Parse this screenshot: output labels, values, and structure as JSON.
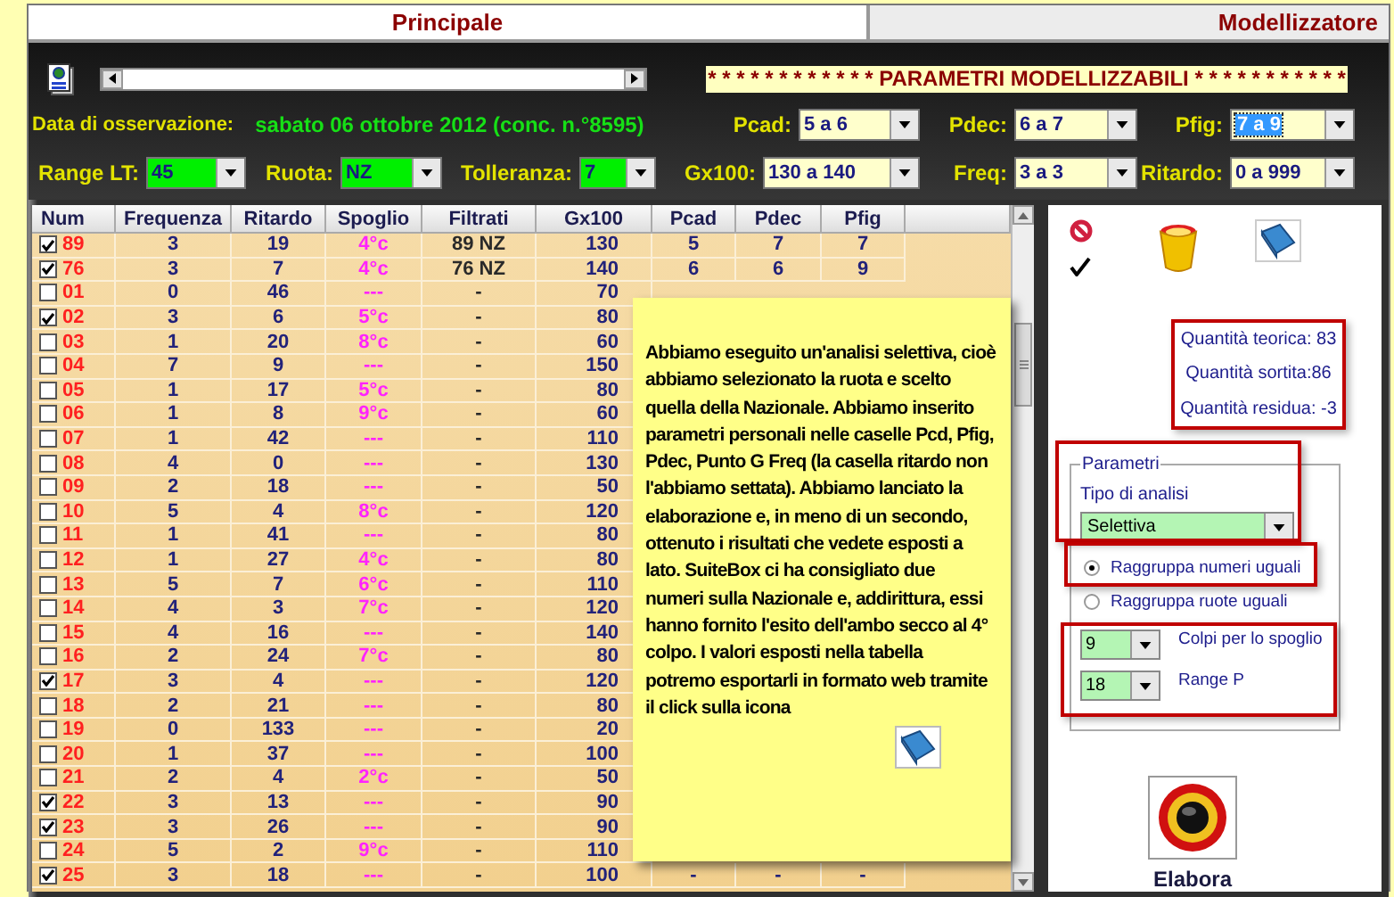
{
  "tabs": [
    {
      "label": "Principale",
      "selected": true
    },
    {
      "label": "Modellizzatore",
      "selected": false
    }
  ],
  "top": {
    "banner": "* * * * * * * * * * * * PARAMETRI MODELLIZZABILI * * * * * * * * * * *",
    "date_label": "Data di osservazione:",
    "date_value": "sabato 06 ottobre 2012 (conc. n.°8595)",
    "params_row1": [
      {
        "label": "Pcad:",
        "value": "5 a 6",
        "highlighted": false
      },
      {
        "label": "Pdec:",
        "value": "6 a 7",
        "highlighted": false
      },
      {
        "label": "Pfig:",
        "value": "7 a 9",
        "highlighted": true
      }
    ],
    "filters": [
      {
        "label": "Range LT:",
        "value": "45"
      },
      {
        "label": "Ruota:",
        "value": "NZ"
      },
      {
        "label": "Tolleranza:",
        "value": "7"
      }
    ],
    "params_row2": [
      {
        "label": "Gx100:",
        "value": "130 a 140",
        "highlighted": false
      },
      {
        "label": "Freq:",
        "value": "3 a 3",
        "highlighted": false
      },
      {
        "label": "Ritardo:",
        "value": "0 a 999",
        "highlighted": false
      }
    ]
  },
  "table": {
    "columns": [
      "Num",
      "Frequenza",
      "Ritardo",
      "Spoglio",
      "Filtrati",
      "Gx100",
      "Pcad",
      "Pdec",
      "Pfig"
    ],
    "rows": [
      {
        "num": "89",
        "checked": true,
        "freq": "3",
        "ritardo": "19",
        "spoglio": "4°c",
        "filtrati": "89 NZ",
        "gx100": "130",
        "pcad": "5",
        "pdec": "7",
        "pfig": "7"
      },
      {
        "num": "76",
        "checked": true,
        "freq": "3",
        "ritardo": "7",
        "spoglio": "4°c",
        "filtrati": "76 NZ",
        "gx100": "140",
        "pcad": "6",
        "pdec": "6",
        "pfig": "9"
      },
      {
        "num": "01",
        "checked": false,
        "freq": "0",
        "ritardo": "46",
        "spoglio": "---",
        "filtrati": "-",
        "gx100": "70"
      },
      {
        "num": "02",
        "checked": true,
        "freq": "3",
        "ritardo": "6",
        "spoglio": "5°c",
        "filtrati": "-",
        "gx100": "80"
      },
      {
        "num": "03",
        "checked": false,
        "freq": "1",
        "ritardo": "20",
        "spoglio": "8°c",
        "filtrati": "-",
        "gx100": "60"
      },
      {
        "num": "04",
        "checked": false,
        "freq": "7",
        "ritardo": "9",
        "spoglio": "---",
        "filtrati": "-",
        "gx100": "150"
      },
      {
        "num": "05",
        "checked": false,
        "freq": "1",
        "ritardo": "17",
        "spoglio": "5°c",
        "filtrati": "-",
        "gx100": "80"
      },
      {
        "num": "06",
        "checked": false,
        "freq": "1",
        "ritardo": "8",
        "spoglio": "9°c",
        "filtrati": "-",
        "gx100": "60"
      },
      {
        "num": "07",
        "checked": false,
        "freq": "1",
        "ritardo": "42",
        "spoglio": "---",
        "filtrati": "-",
        "gx100": "110"
      },
      {
        "num": "08",
        "checked": false,
        "freq": "4",
        "ritardo": "0",
        "spoglio": "---",
        "filtrati": "-",
        "gx100": "130"
      },
      {
        "num": "09",
        "checked": false,
        "freq": "2",
        "ritardo": "18",
        "spoglio": "---",
        "filtrati": "-",
        "gx100": "50"
      },
      {
        "num": "10",
        "checked": false,
        "freq": "5",
        "ritardo": "4",
        "spoglio": "8°c",
        "filtrati": "-",
        "gx100": "120"
      },
      {
        "num": "11",
        "checked": false,
        "freq": "1",
        "ritardo": "41",
        "spoglio": "---",
        "filtrati": "-",
        "gx100": "80"
      },
      {
        "num": "12",
        "checked": false,
        "freq": "1",
        "ritardo": "27",
        "spoglio": "4°c",
        "filtrati": "-",
        "gx100": "80"
      },
      {
        "num": "13",
        "checked": false,
        "freq": "5",
        "ritardo": "7",
        "spoglio": "6°c",
        "filtrati": "-",
        "gx100": "110"
      },
      {
        "num": "14",
        "checked": false,
        "freq": "4",
        "ritardo": "3",
        "spoglio": "7°c",
        "filtrati": "-",
        "gx100": "120"
      },
      {
        "num": "15",
        "checked": false,
        "freq": "4",
        "ritardo": "16",
        "spoglio": "---",
        "filtrati": "-",
        "gx100": "140"
      },
      {
        "num": "16",
        "checked": false,
        "freq": "2",
        "ritardo": "24",
        "spoglio": "7°c",
        "filtrati": "-",
        "gx100": "80"
      },
      {
        "num": "17",
        "checked": true,
        "freq": "3",
        "ritardo": "4",
        "spoglio": "---",
        "filtrati": "-",
        "gx100": "120"
      },
      {
        "num": "18",
        "checked": false,
        "freq": "2",
        "ritardo": "21",
        "spoglio": "---",
        "filtrati": "-",
        "gx100": "80"
      },
      {
        "num": "19",
        "checked": false,
        "freq": "0",
        "ritardo": "133",
        "spoglio": "---",
        "filtrati": "-",
        "gx100": "20"
      },
      {
        "num": "20",
        "checked": false,
        "freq": "1",
        "ritardo": "37",
        "spoglio": "---",
        "filtrati": "-",
        "gx100": "100"
      },
      {
        "num": "21",
        "checked": false,
        "freq": "2",
        "ritardo": "4",
        "spoglio": "2°c",
        "filtrati": "-",
        "gx100": "50"
      },
      {
        "num": "22",
        "checked": true,
        "freq": "3",
        "ritardo": "13",
        "spoglio": "---",
        "filtrati": "-",
        "gx100": "90"
      },
      {
        "num": "23",
        "checked": true,
        "freq": "3",
        "ritardo": "26",
        "spoglio": "---",
        "filtrati": "-",
        "gx100": "90"
      },
      {
        "num": "24",
        "checked": false,
        "freq": "5",
        "ritardo": "2",
        "spoglio": "9°c",
        "filtrati": "-",
        "gx100": "110"
      },
      {
        "num": "25",
        "checked": true,
        "freq": "3",
        "ritardo": "18",
        "spoglio": "---",
        "filtrati": "-",
        "gx100": "100",
        "pcad": "-",
        "pdec": "-",
        "pfig": "-"
      }
    ]
  },
  "note": {
    "text": "Abbiamo eseguito un'analisi selettiva, cioè abbiamo selezionato la ruota e scelto quella della Nazionale. Abbiamo inserito parametri personali nelle caselle Pcd, Pfig, Pdec, Punto G Freq (la casella ritardo non l'abbiamo settata). Abbiamo lanciato la elaborazione e, in meno di un secondo, ottenuto i risultati che vedete esposti a lato. SuiteBox ci ha consigliato due numeri sulla Nazionale e, addirittura, essi hanno fornito l'esito dell'ambo secco al 4° colpo. I valori esposti nella tabella potremo esportarli in formato web tramite il click sulla icona"
  },
  "right_panel": {
    "stats": [
      "Quantità teorica: 83",
      "Quantità sortita:86",
      "Quantità residua: -3"
    ],
    "group_title": "Parametri",
    "analysis_label": "Tipo di analisi",
    "analysis_value": "Selettiva",
    "options": [
      {
        "label": "Raggruppa numeri uguali",
        "selected": true
      },
      {
        "label": "Raggruppa ruote uguali",
        "selected": false
      }
    ],
    "spinners": [
      {
        "value": "9",
        "label": "Colpi per lo spoglio"
      },
      {
        "value": "18",
        "label": "Range P"
      }
    ],
    "run_button": "Elabora"
  }
}
